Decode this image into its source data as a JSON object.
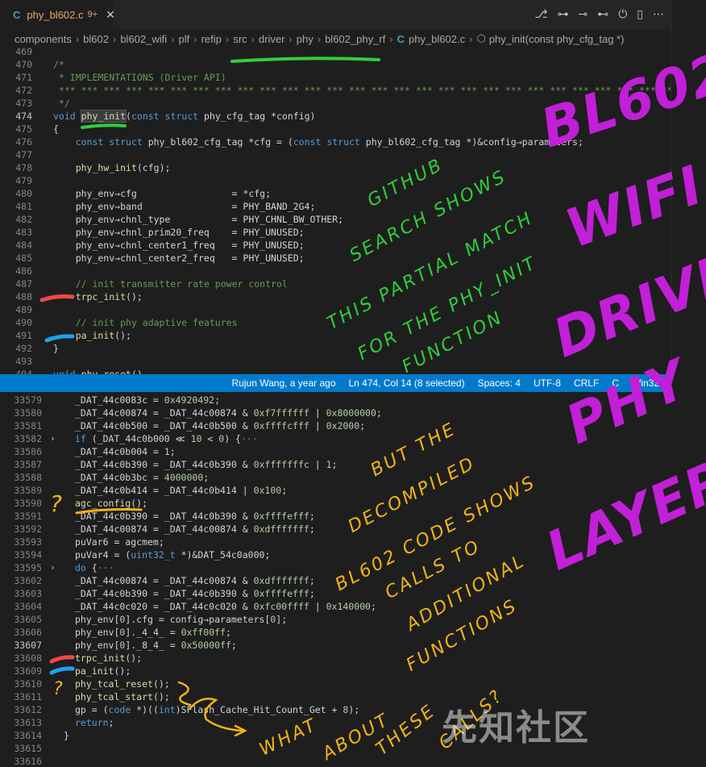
{
  "tab": {
    "lang": "C",
    "filename": "phy_bl602.c",
    "badge": "9+",
    "close": "✕"
  },
  "actions": [
    "⎇",
    "⊶",
    "⊸",
    "⊷",
    "⏻",
    "▯",
    "⋯"
  ],
  "breadcrumbs": [
    "components",
    "bl602",
    "bl602_wifi",
    "plf",
    "refip",
    "src",
    "driver",
    "phy",
    "bl602_phy_rf"
  ],
  "breadcrumb_file": "phy_bl602.c",
  "breadcrumb_symbol": "phy_init(const phy_cfg_tag *)",
  "upper_lines": [
    {
      "n": "469",
      "code": ""
    },
    {
      "n": "470",
      "code": "/*"
    },
    {
      "n": "471",
      "code": " * IMPLEMENTATIONS (Driver API)"
    },
    {
      "n": "472",
      "code": " *** *** *** *** *** *** *** *** *** *** *** *** *** *** *** *** *** *** *** *** *** *** *** *** *** *** *** *** ***"
    },
    {
      "n": "473",
      "code": " */"
    },
    {
      "n": "474",
      "code": "void phy_init(const struct phy_cfg_tag *config)"
    },
    {
      "n": "475",
      "code": "{"
    },
    {
      "n": "476",
      "code": "    const struct phy_bl602_cfg_tag *cfg = (const struct phy_bl602_cfg_tag *)&config→parameters;"
    },
    {
      "n": "477",
      "code": ""
    },
    {
      "n": "478",
      "code": "    phy_hw_init(cfg);"
    },
    {
      "n": "479",
      "code": ""
    },
    {
      "n": "480",
      "code": "    phy_env→cfg                 = *cfg;"
    },
    {
      "n": "481",
      "code": "    phy_env→band                = PHY_BAND_2G4;"
    },
    {
      "n": "482",
      "code": "    phy_env→chnl_type           = PHY_CHNL_BW_OTHER;"
    },
    {
      "n": "483",
      "code": "    phy_env→chnl_prim20_freq    = PHY_UNUSED;"
    },
    {
      "n": "484",
      "code": "    phy_env→chnl_center1_freq   = PHY_UNUSED;"
    },
    {
      "n": "485",
      "code": "    phy_env→chnl_center2_freq   = PHY_UNUSED;"
    },
    {
      "n": "486",
      "code": ""
    },
    {
      "n": "487",
      "code": "    // init transmitter rate power control"
    },
    {
      "n": "488",
      "code": "    trpc_init();"
    },
    {
      "n": "489",
      "code": ""
    },
    {
      "n": "490",
      "code": "    // init phy adaptive features"
    },
    {
      "n": "491",
      "code": "    pa_init();"
    },
    {
      "n": "492",
      "code": "}"
    },
    {
      "n": "493",
      "code": ""
    },
    {
      "n": "494",
      "code": "void phy_reset()"
    }
  ],
  "status": {
    "author": "Rujun Wang, a year ago",
    "position": "Ln 474, Col 14 (8 selected)",
    "spaces": "Spaces: 4",
    "encoding": "UTF-8",
    "eol": "CRLF",
    "language": "C",
    "platform": "Win32"
  },
  "lower_lines": [
    {
      "n": "33579",
      "code": "_DAT_44c0083c = 0x4920492;"
    },
    {
      "n": "33580",
      "code": "_DAT_44c00874 = _DAT_44c00874 & 0xf7ffffff | 0x8000000;"
    },
    {
      "n": "33581",
      "code": "_DAT_44c0b500 = _DAT_44c0b500 & 0xffffcfff | 0x2000;"
    },
    {
      "n": "33582",
      "code": "if (_DAT_44c0b000 ≪ 10 < 0) {···",
      "fold": true,
      "indent": -1
    },
    {
      "n": "33586",
      "code": "_DAT_44c0b004 = 1;"
    },
    {
      "n": "33587",
      "code": "_DAT_44c0b390 = _DAT_44c0b390 & 0xfffffffc | 1;"
    },
    {
      "n": "33588",
      "code": "_DAT_44c0b3bc = 4000000;"
    },
    {
      "n": "33589",
      "code": "_DAT_44c0b414 = _DAT_44c0b414 | 0x100;"
    },
    {
      "n": "33590",
      "code": "agc_config();",
      "indent": -1
    },
    {
      "n": "33591",
      "code": "_DAT_44c0b390 = _DAT_44c0b390 & 0xffffefff;"
    },
    {
      "n": "33592",
      "code": "_DAT_44c00874 = _DAT_44c00874 & 0xdfffffff;"
    },
    {
      "n": "33593",
      "code": "puVar6 = agcmem;",
      "indent": -1
    },
    {
      "n": "33594",
      "code": "puVar4 = (uint32_t *)&DAT_54c0a000;",
      "indent": -1
    },
    {
      "n": "33595",
      "code": "do {···",
      "fold": true,
      "indent": -1
    },
    {
      "n": "33602",
      "code": "_DAT_44c00874 = _DAT_44c00874 & 0xdfffffff;"
    },
    {
      "n": "33603",
      "code": "_DAT_44c0b390 = _DAT_44c0b390 & 0xffffefff;"
    },
    {
      "n": "33604",
      "code": "_DAT_44c0c020 = _DAT_44c0c020 & 0xfc00ffff | 0x140000;"
    },
    {
      "n": "33605",
      "code": "phy_env[0].cfg = config→parameters[0];",
      "indent": -1
    },
    {
      "n": "33606",
      "code": "phy_env[0]._4_4_ = 0xff00ff;",
      "indent": -1
    },
    {
      "n": "33607",
      "code": "phy_env[0]._8_4_ = 0x50000ff;",
      "indent": -1,
      "current": true
    },
    {
      "n": "33608",
      "code": "trpc_init();",
      "indent": -1
    },
    {
      "n": "33609",
      "code": "pa_init();",
      "indent": -1
    },
    {
      "n": "33610",
      "code": "phy_tcal_reset();",
      "indent": -1
    },
    {
      "n": "33611",
      "code": "phy_tcal_start();",
      "indent": -1
    },
    {
      "n": "33612",
      "code": "gp = (code *)((int)SFlash_Cache_Hit_Count_Get + 8);",
      "indent": -1
    },
    {
      "n": "33613",
      "code": "return;",
      "indent": -1
    },
    {
      "n": "33614",
      "code": "}",
      "indent": -2
    },
    {
      "n": "33615",
      "code": ""
    },
    {
      "n": "33616",
      "code": ""
    }
  ],
  "annotations": {
    "green": [
      "GITHUB",
      "SEARCH SHOWS",
      "THIS PARTIAL MATCH",
      "FOR THE PHY_INIT",
      "FUNCTION"
    ],
    "purple": [
      "BL602",
      "WIFI",
      "DRIVER",
      "PHY",
      "LAYER"
    ],
    "yellow": [
      "BUT THE",
      "DECOMPILED",
      "BL602 CODE SHOWS",
      "CALLS TO",
      "ADDITIONAL",
      "FUNCTIONS"
    ],
    "what": [
      "WHAT",
      "ABOUT",
      "THESE",
      "CALLS?"
    ],
    "q1": "?",
    "q2": "?"
  },
  "watermark": "先知社区",
  "colors": {
    "status_bar": "#007acc",
    "annotation_green": "#2fcf3a",
    "annotation_purple": "#c21fd8",
    "annotation_yellow": "#f2b417",
    "mark_red": "#f04848",
    "mark_blue": "#1aa3f0"
  }
}
